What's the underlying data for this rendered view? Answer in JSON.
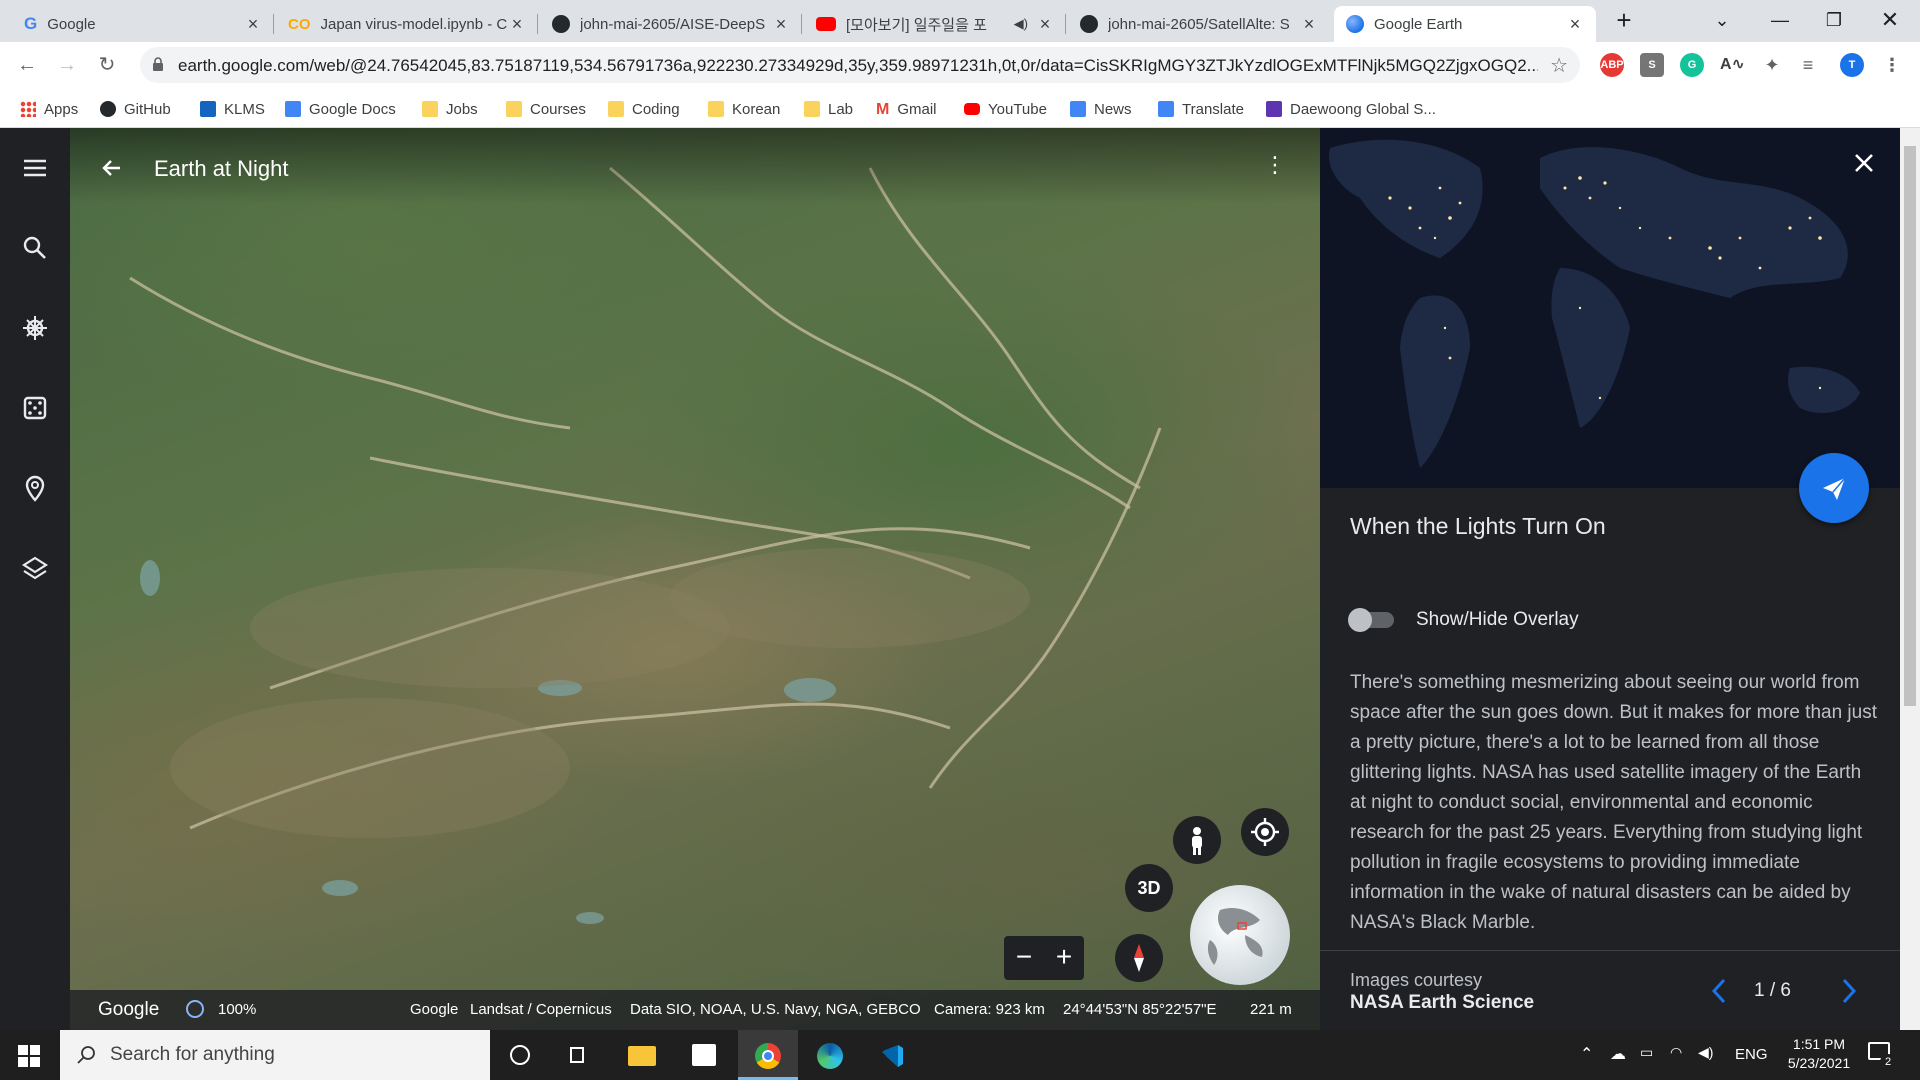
{
  "browser": {
    "tabs": [
      {
        "title": "Google",
        "favicon": "google-icon",
        "color": "#4285f4"
      },
      {
        "title": "Japan virus-model.ipynb - C",
        "favicon": "colab-icon",
        "color": "#f9ab00"
      },
      {
        "title": "john-mai-2605/AISE-DeepS",
        "favicon": "github-icon",
        "color": "#24292e"
      },
      {
        "title": "[모아보기] 일주일을 포",
        "favicon": "youtube-icon",
        "color": "#ff0000"
      },
      {
        "title": "john-mai-2605/SatellAlte: S",
        "favicon": "github-icon",
        "color": "#24292e"
      },
      {
        "title": "Google Earth",
        "favicon": "google-earth-icon",
        "color": "#4285f4"
      }
    ],
    "url": "earth.google.com/web/@24.76542045,83.75187119,534.56791736a,922230.27334929d,35y,359.98971231h,0t,0r/data=CisSKRIgMGY3ZTJkYzdlOGExMTFlNjk5MGQ2ZjgxOGQ2...",
    "profile_initial": "T",
    "extensions": [
      "ABP",
      "S",
      "G"
    ],
    "bookmarks": [
      {
        "label": "Apps",
        "icon": "apps-grid-icon"
      },
      {
        "label": "GitHub",
        "icon": "github-icon"
      },
      {
        "label": "KLMS",
        "icon": "klms-icon"
      },
      {
        "label": "Google Docs",
        "icon": "docs-icon"
      },
      {
        "label": "Jobs",
        "icon": "folder-icon"
      },
      {
        "label": "Courses",
        "icon": "folder-icon"
      },
      {
        "label": "Coding",
        "icon": "folder-icon"
      },
      {
        "label": "Korean",
        "icon": "folder-icon"
      },
      {
        "label": "Lab",
        "icon": "folder-icon"
      },
      {
        "label": "Gmail",
        "icon": "gmail-icon"
      },
      {
        "label": "YouTube",
        "icon": "youtube-icon"
      },
      {
        "label": "News",
        "icon": "news-icon"
      },
      {
        "label": "Translate",
        "icon": "translate-icon"
      },
      {
        "label": "Daewoong Global S...",
        "icon": "daewoong-icon"
      }
    ]
  },
  "earth": {
    "title": "Earth at Night",
    "mode_3d": "3D",
    "status": {
      "brand": "Google",
      "loading": "100%",
      "attrib_google": "Google",
      "attrib_landsat": "Landsat / Copernicus",
      "attrib_data": "Data SIO, NOAA, U.S. Navy, NGA, GEBCO",
      "camera": "Camera: 923 km",
      "coords": "24°44'53\"N 85°22'57\"E",
      "elevation": "221 m"
    }
  },
  "panel": {
    "title": "When the Lights Turn On",
    "toggle_label": "Show/Hide Overlay",
    "toggle_on": false,
    "body": "There's something mesmerizing about seeing our world from space after the sun goes down. But it makes for more than just a pretty picture, there's a lot to be learned from all those glittering lights. NASA has used satellite imagery of the Earth at night to conduct social, environmental and economic research for the past 25 years. Everything from studying light pollution in fragile ecosystems to providing immediate information in the wake of natural disasters can be aided by NASA's Black Marble.",
    "credit_label": "Images courtesy",
    "credit_source": "NASA Earth Science",
    "pager": "1 / 6",
    "accent": "#1a73e8"
  },
  "taskbar": {
    "search_placeholder": "Search for anything",
    "lang": "ENG",
    "time": "1:51 PM",
    "date": "5/23/2021",
    "notifications": "2"
  }
}
